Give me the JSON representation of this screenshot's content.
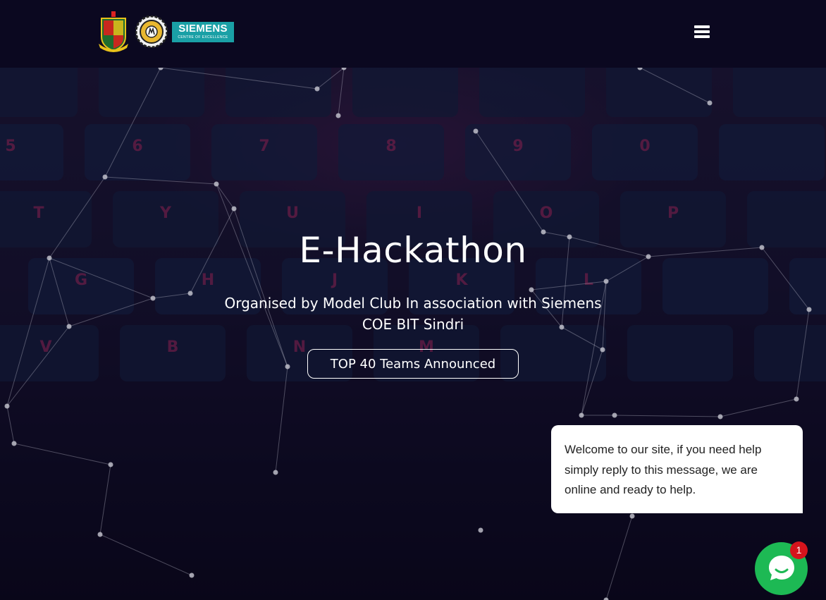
{
  "header": {
    "logos": [
      {
        "name": "bit-sindri-crest-logo"
      },
      {
        "name": "model-club-gear-logo"
      },
      {
        "name": "siemens-coe-logo",
        "brand": "SIEMENS",
        "subtitle": "CENTRE OF EXCELLENCE",
        "color": "#1aa0a6"
      }
    ],
    "menu_icon": "hamburger-menu-icon"
  },
  "hero": {
    "title": "E-Hackathon",
    "subtitle": "Organised by Model Club In association with Siemens COE BIT Sindri",
    "button_label": "TOP 40 Teams Announced",
    "background": "keyboard-photo-with-particle-network"
  },
  "chat_widget": {
    "message": "Welcome to our site, if you need help simply reply to this message, we are online and ready to help.",
    "unread_count": "1",
    "button_color": "#1db954",
    "badge_color": "#d6141c"
  }
}
